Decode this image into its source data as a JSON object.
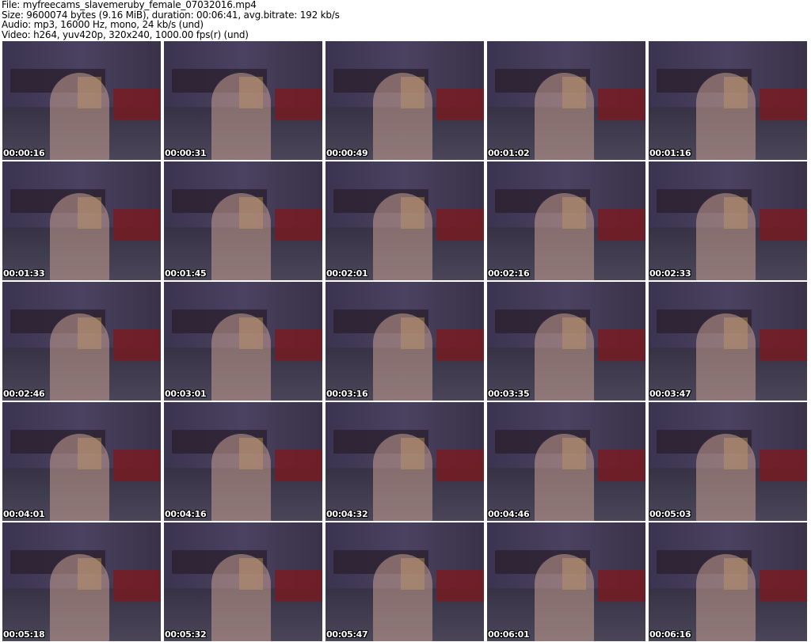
{
  "info": {
    "file": "File: myfreecams_slavemeruby_female_07032016.mp4",
    "size": "Size: 9600074 bytes (9.16 MiB), duration: 00:06:41, avg.bitrate: 192 kb/s",
    "audio": "Audio: mp3, 16000 Hz, mono, 24 kb/s (und)",
    "video": "Video: h264, yuv420p, 320x240, 1000.00 fps(r) (und)"
  },
  "thumbnails": [
    "00:00:16",
    "00:00:31",
    "00:00:49",
    "00:01:02",
    "00:01:16",
    "00:01:33",
    "00:01:45",
    "00:02:01",
    "00:02:16",
    "00:02:33",
    "00:02:46",
    "00:03:01",
    "00:03:16",
    "00:03:35",
    "00:03:47",
    "00:04:01",
    "00:04:16",
    "00:04:32",
    "00:04:46",
    "00:05:03",
    "00:05:18",
    "00:05:32",
    "00:05:47",
    "00:06:01",
    "00:06:16"
  ]
}
